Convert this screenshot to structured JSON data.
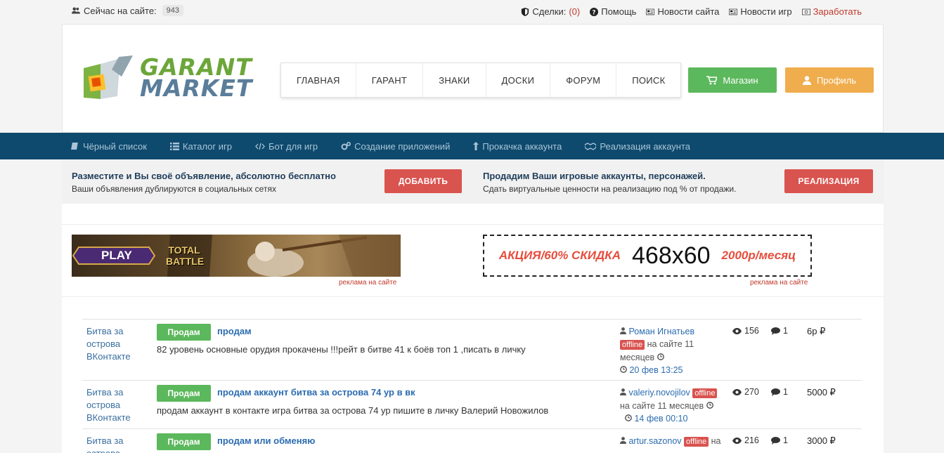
{
  "topbar": {
    "online_label": "Сейчас на сайте:",
    "online_count": "943",
    "links": {
      "deals_label": "Сделки:",
      "deals_count": "(0)",
      "help": "Помощь",
      "site_news": "Новости сайта",
      "game_news": "Новости игр",
      "earn": "Заработать"
    }
  },
  "header": {
    "logo_line1": "GARANT",
    "logo_line2": "MARKET",
    "nav": [
      "ГЛАВНАЯ",
      "ГАРАНТ",
      "ЗНАКИ",
      "ДОСКИ",
      "ФОРУМ",
      "ПОИСК"
    ],
    "shop_button": "Магазин",
    "profile_button": "Профиль"
  },
  "subnav": [
    "Чёрный список",
    "Каталог игр",
    "Бот для игр",
    "Создание приложений",
    "Прокачка аккаунта",
    "Реализация аккаунта"
  ],
  "promo": {
    "left_title": "Разместите и Вы своё объявление, абсолютно бесплатно",
    "left_sub": "Ваши объявления дублируются в социальных сетях",
    "left_button": "ДОБАВИТЬ",
    "right_title": "Продадим Ваши игровые аккаунты, персонажей.",
    "right_sub": "Сдать виртуальные ценности на реализацию под % от продажи.",
    "right_button": "РЕАЛИЗАЦИЯ"
  },
  "banners": {
    "left_play": "PLAY",
    "left_game": "TOTAL BATTLE",
    "left_caption": "реклама на сайте",
    "right_promo1": "АКЦИЯ/60% СКИДКА",
    "right_size": "468x60",
    "right_promo2": "2000р/месяц",
    "right_caption": "реклама на сайте"
  },
  "listings": [
    {
      "game": "Битва за острова ВКонтакте",
      "badge": "Продам",
      "title": "продам",
      "desc": "82 уровень основные орудия прокачены !!!рейт в битве 41 к боёв топ 1 ,писать в личку",
      "author": "Роман Игнатьев",
      "status": "offline",
      "seen": "на сайте 11 месяцев",
      "date": "20 фев 13:25",
      "views": "156",
      "comments": "1",
      "price": "6р ₽"
    },
    {
      "game": "Битва за острова ВКонтакте",
      "badge": "Продам",
      "title": "продам аккаунт битва за острова 74 ур в вк",
      "desc": "продам аккаунт в контакте игра битва за острова 74 ур пишите в личку Валерий Новожилов",
      "author": "valeriy.novojilov",
      "status": "offline",
      "seen": "на сайте 11 месяцев",
      "date": "14 фев 00:10",
      "views": "270",
      "comments": "1",
      "price": "5000 ₽"
    },
    {
      "game": "Битва за острова",
      "badge": "Продам",
      "title": "продам или обменяю",
      "desc": "",
      "author": "artur.sazonov",
      "status": "offline",
      "seen": "на",
      "date": "",
      "views": "216",
      "comments": "1",
      "price": "3000 ₽"
    }
  ]
}
